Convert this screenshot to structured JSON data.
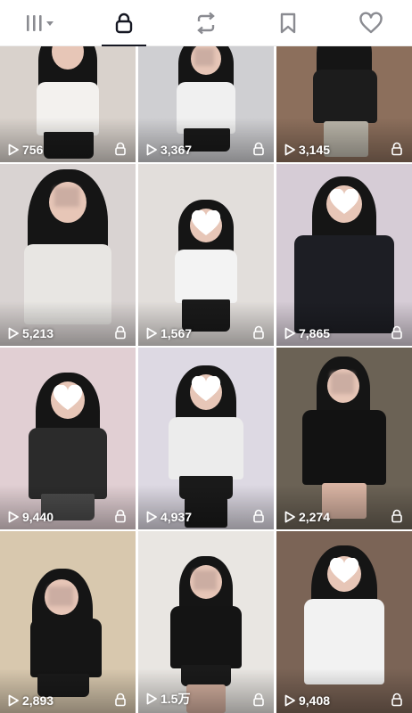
{
  "tabs": [
    {
      "name": "grid-filter",
      "icon": "grid-filter-icon"
    },
    {
      "name": "private",
      "icon": "lock-icon",
      "active": true
    },
    {
      "name": "reposts",
      "icon": "repost-icon"
    },
    {
      "name": "favorites",
      "icon": "bookmark-icon"
    },
    {
      "name": "liked",
      "icon": "heart-icon"
    }
  ],
  "videos": [
    {
      "views": "756",
      "locked": true,
      "bg": "#d9d2cc",
      "shirt": "#f3f1ee"
    },
    {
      "views": "3,367",
      "locked": true,
      "bg": "#cfcfd2",
      "shirt": "#f0f0f0"
    },
    {
      "views": "3,145",
      "locked": true,
      "bg": "#8c6f5c",
      "shirt": "#1c1c1c"
    },
    {
      "views": "5,213",
      "locked": true,
      "bg": "#d9d3d2",
      "shirt": "#e8e6e3"
    },
    {
      "views": "1,567",
      "locked": true,
      "bg": "#e2dedb",
      "shirt": "#f3f3f3"
    },
    {
      "views": "7,865",
      "locked": true,
      "bg": "#d6ccd6",
      "shirt": "#1d1e24"
    },
    {
      "views": "9,440",
      "locked": true,
      "bg": "#e1cfd3",
      "shirt": "#2b2b2b"
    },
    {
      "views": "4,937",
      "locked": true,
      "bg": "#ddd9e3",
      "shirt": "#ececec"
    },
    {
      "views": "2,274",
      "locked": true,
      "bg": "#6b6255",
      "shirt": "#121212"
    },
    {
      "views": "2,893",
      "locked": true,
      "bg": "#d8c8ae",
      "shirt": "#151515"
    },
    {
      "views": "1.5万",
      "locked": true,
      "bg": "#e9e6e2",
      "shirt": "#141414"
    },
    {
      "views": "9,408",
      "locked": true,
      "bg": "#7b6456",
      "shirt": "#f2f2f2"
    }
  ],
  "colors": {
    "icon": "#161823",
    "text_on_thumb": "#ffffff"
  }
}
